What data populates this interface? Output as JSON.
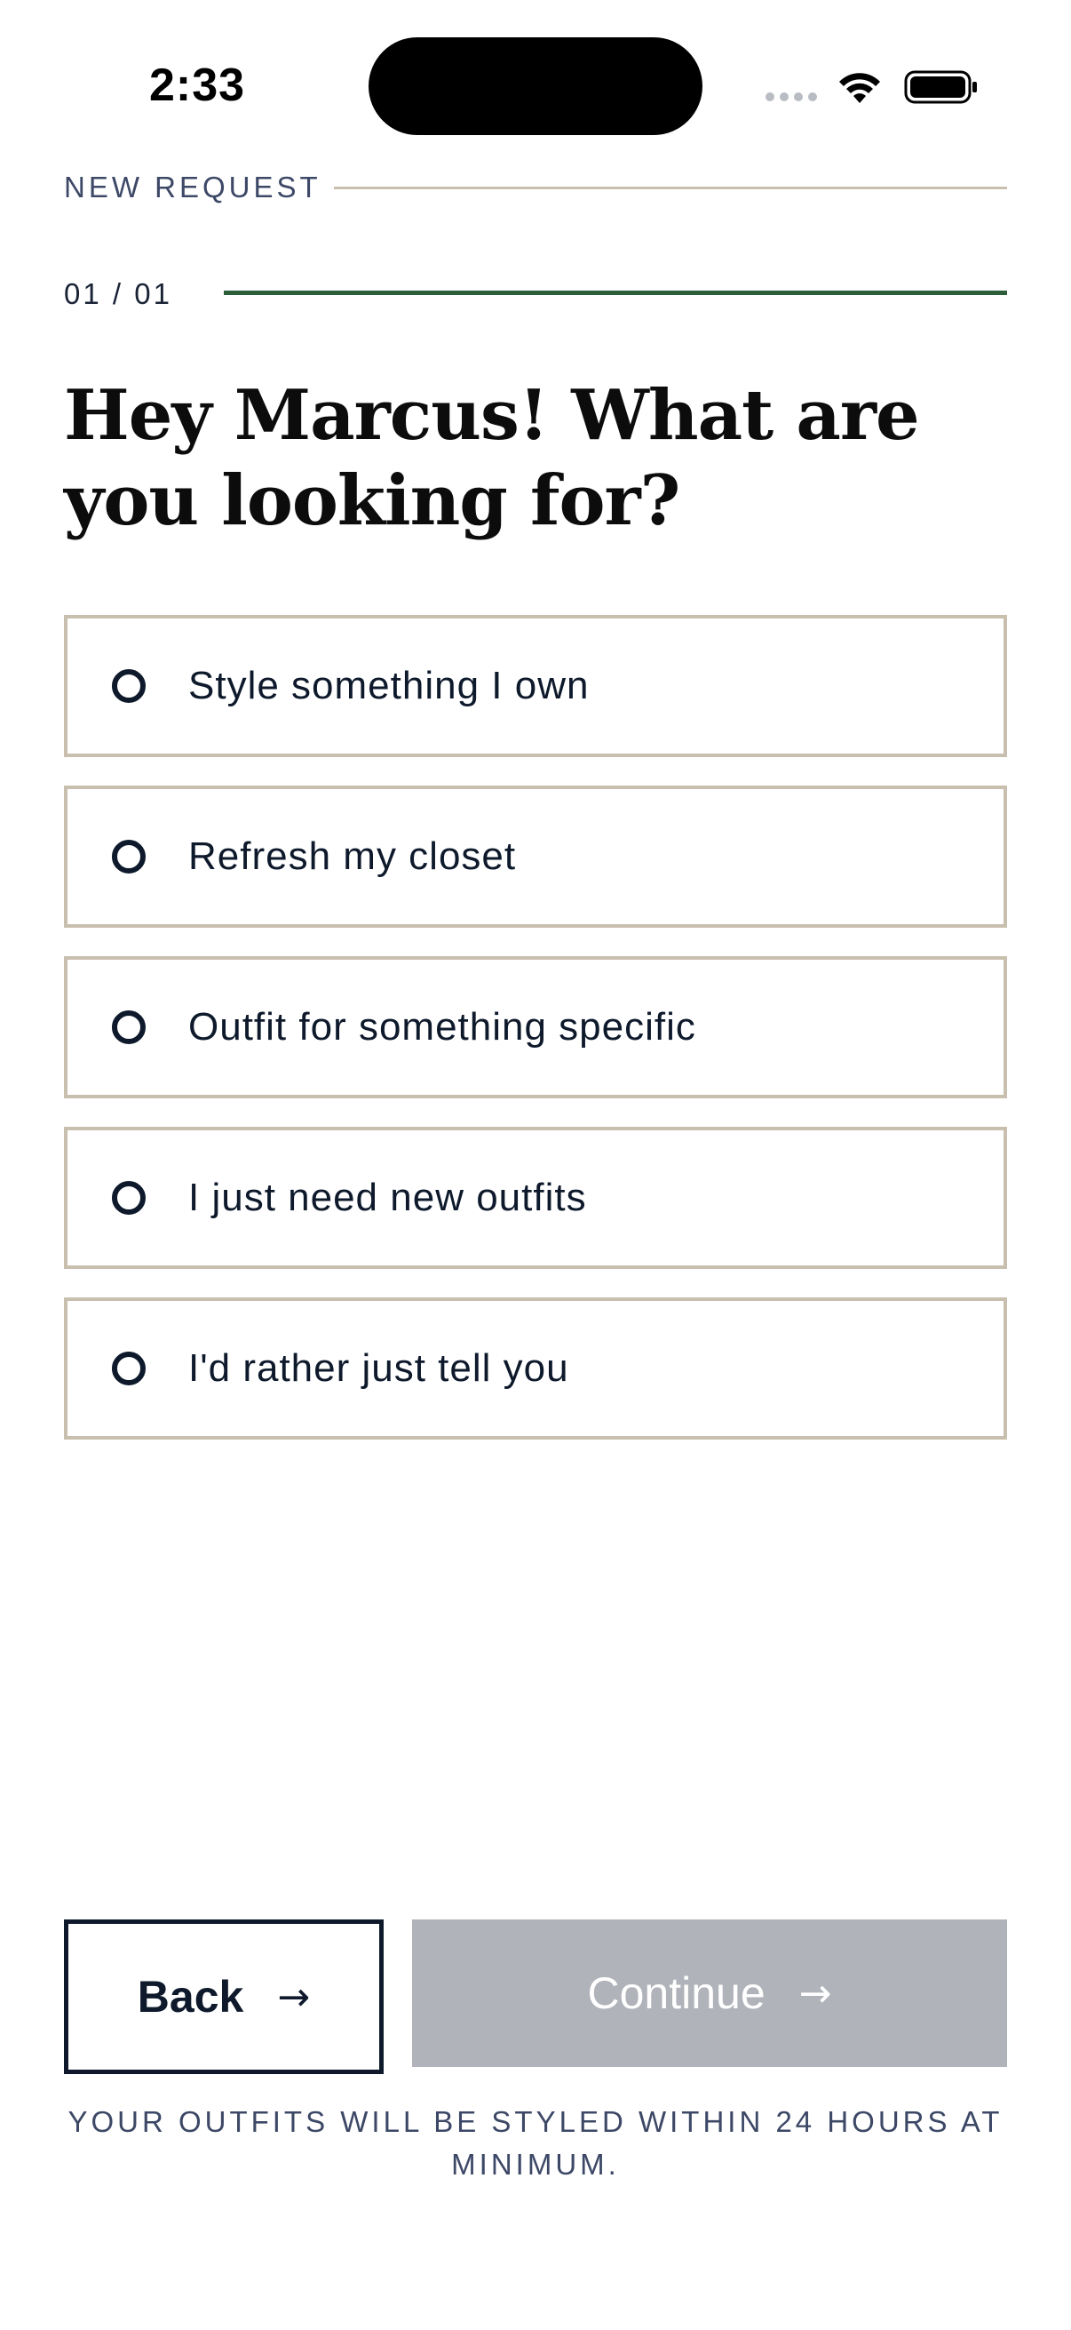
{
  "status_bar": {
    "time": "2:33",
    "signal_icon": "cellular-signal-icon",
    "wifi_icon": "wifi-icon",
    "battery_icon": "battery-icon"
  },
  "header": {
    "eyebrow": "NEW REQUEST",
    "step_label": "01 / 01",
    "progress": 1.0
  },
  "title": "Hey Marcus! What are you looking for?",
  "options": [
    {
      "label": "Style something I own",
      "selected": false
    },
    {
      "label": "Refresh my closet",
      "selected": false
    },
    {
      "label": "Outfit for something specific",
      "selected": false
    },
    {
      "label": "I just need new outfits",
      "selected": false
    },
    {
      "label": "I'd rather just tell you",
      "selected": false
    }
  ],
  "actions": {
    "back_label": "Back",
    "continue_label": "Continue",
    "arrow": "→",
    "continue_enabled": false
  },
  "footnote": "YOUR OUTFITS WILL BE STYLED WITHIN 24 HOURS AT MINIMUM.",
  "colors": {
    "accent_green": "#2c5e3a",
    "border_tan": "#c9bfae",
    "ink": "#0e1a2c",
    "disabled_gray": "#b1b3ba"
  }
}
